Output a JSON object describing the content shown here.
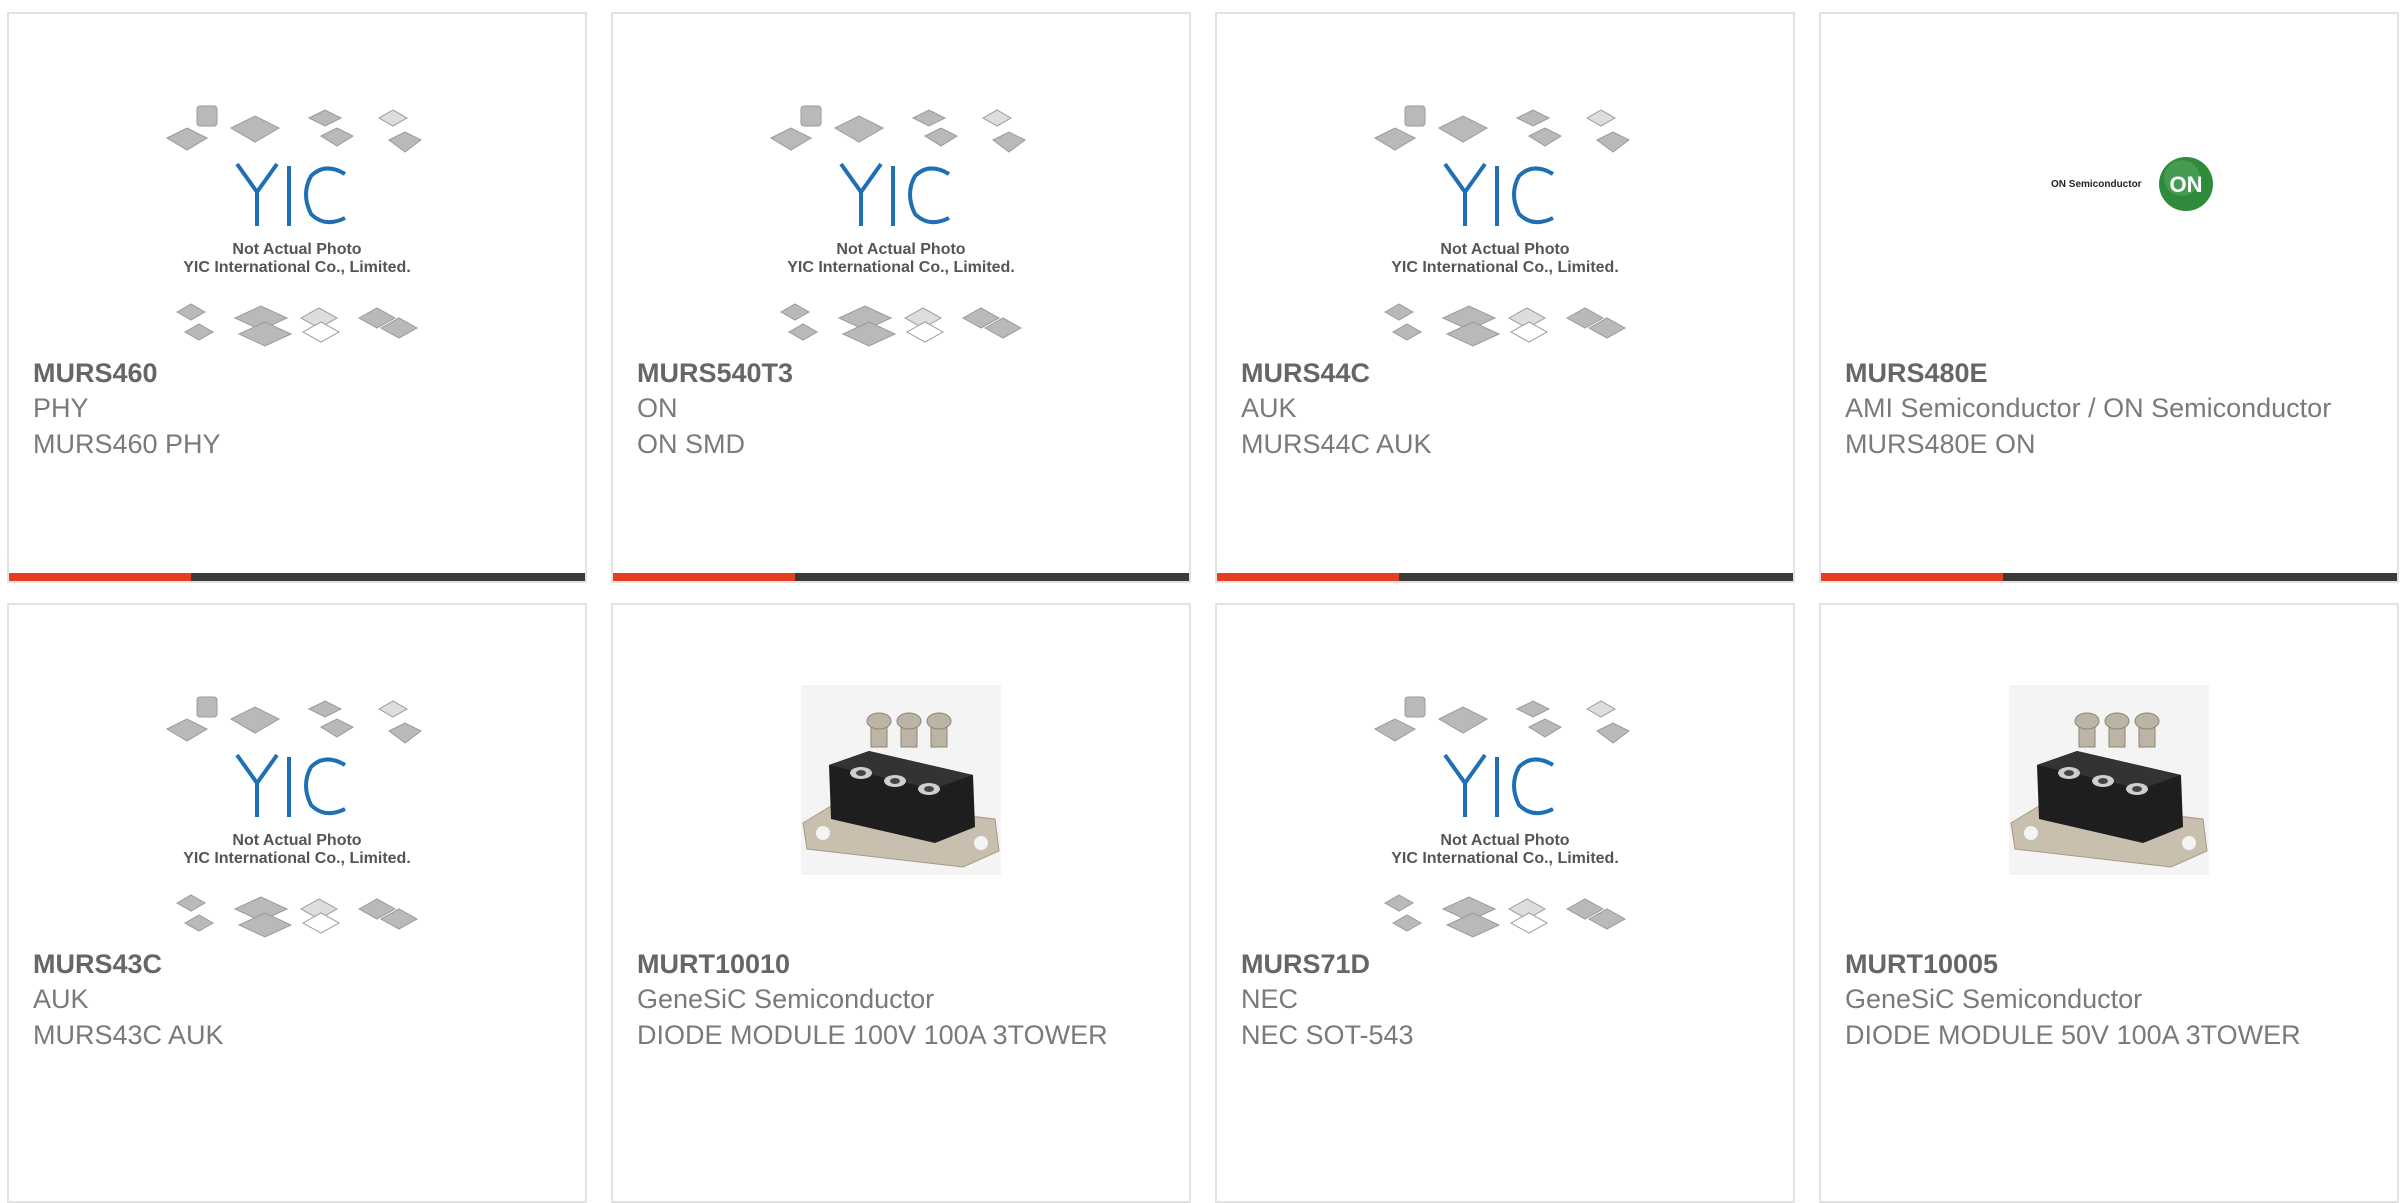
{
  "accent_color": "#e4401f",
  "bar_color": "#3a3a3a",
  "placeholder_caption": {
    "line1": "Not Actual Photo",
    "line2": "YIC International Co., Limited."
  },
  "products": [
    {
      "part": "MURS460",
      "maker": "PHY",
      "desc": "MURS460 PHY",
      "image": "yic-placeholder"
    },
    {
      "part": "MURS540T3",
      "maker": "ON",
      "desc": "ON SMD",
      "image": "yic-placeholder"
    },
    {
      "part": "MURS44C",
      "maker": "AUK",
      "desc": "MURS44C AUK",
      "image": "yic-placeholder"
    },
    {
      "part": "MURS480E",
      "maker": "AMI Semiconductor / ON Semiconductor",
      "desc": "MURS480E ON",
      "image": "on-semiconductor-logo",
      "logo_text": "ON Semiconductor",
      "logo_badge": "ON"
    },
    {
      "part": "MURS43C",
      "maker": "AUK",
      "desc": "MURS43C AUK",
      "image": "yic-placeholder"
    },
    {
      "part": "MURT10010",
      "maker": "GeneSiC Semiconductor",
      "desc": "DIODE MODULE 100V 100A 3TOWER",
      "image": "diode-module-photo"
    },
    {
      "part": "MURS71D",
      "maker": "NEC",
      "desc": "NEC SOT-543",
      "image": "yic-placeholder"
    },
    {
      "part": "MURT10005",
      "maker": "GeneSiC Semiconductor",
      "desc": "DIODE MODULE 50V 100A 3TOWER",
      "image": "diode-module-photo"
    }
  ]
}
